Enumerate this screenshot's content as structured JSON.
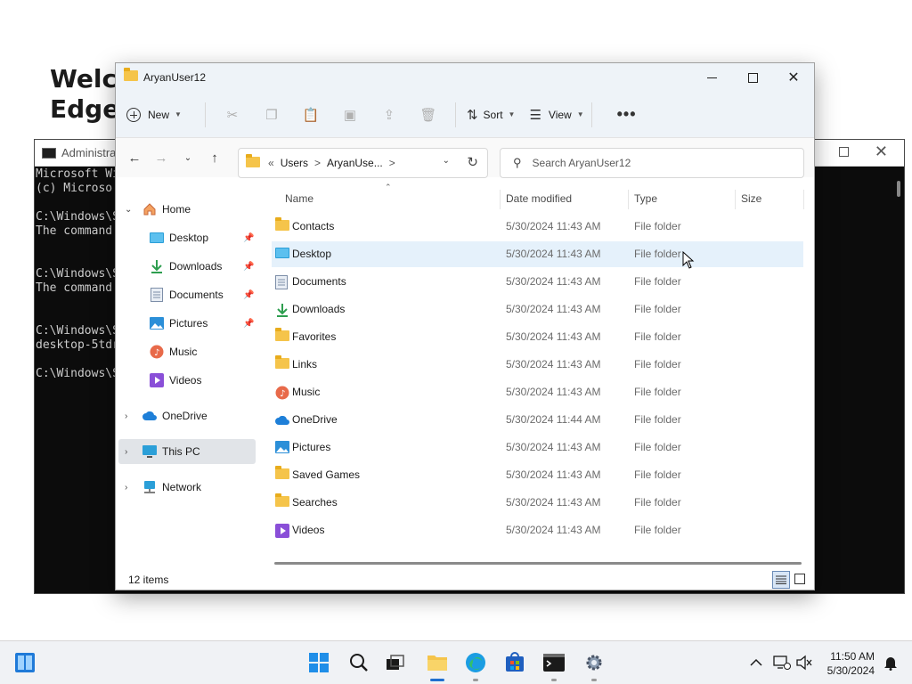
{
  "background": {
    "welcome_line1": "Welco",
    "welcome_line2": "Edge,"
  },
  "cmd": {
    "title": "Administrat",
    "lines": [
      "Microsoft Wi",
      "(c) Microso",
      "",
      "C:\\Windows\\S",
      "The command",
      "",
      "",
      "C:\\Windows\\S",
      "The command",
      "",
      "",
      "C:\\Windows\\S",
      "desktop-5tdr",
      "",
      "C:\\Windows\\S"
    ]
  },
  "explorer": {
    "title": "AryanUser12",
    "toolbar": {
      "new_label": "New",
      "sort_label": "Sort",
      "view_label": "View",
      "more_label": "•••"
    },
    "address": {
      "prefix": "«",
      "crumbs": [
        "Users",
        "AryanUse..."
      ],
      "separator": ">"
    },
    "search": {
      "placeholder": "Search AryanUser12"
    },
    "nav": {
      "home": "Home",
      "desktop": "Desktop",
      "downloads": "Downloads",
      "documents": "Documents",
      "pictures": "Pictures",
      "music": "Music",
      "videos": "Videos",
      "onedrive": "OneDrive",
      "thispc": "This PC",
      "network": "Network"
    },
    "columns": {
      "name": "Name",
      "date": "Date modified",
      "type": "Type",
      "size": "Size"
    },
    "files": [
      {
        "name": "Contacts",
        "date": "5/30/2024 11:43 AM",
        "type": "File folder",
        "icon": "folder-icon"
      },
      {
        "name": "Desktop",
        "date": "5/30/2024 11:43 AM",
        "type": "File folder",
        "icon": "desktop-icon"
      },
      {
        "name": "Documents",
        "date": "5/30/2024 11:43 AM",
        "type": "File folder",
        "icon": "documents-icon"
      },
      {
        "name": "Downloads",
        "date": "5/30/2024 11:43 AM",
        "type": "File folder",
        "icon": "download-icon"
      },
      {
        "name": "Favorites",
        "date": "5/30/2024 11:43 AM",
        "type": "File folder",
        "icon": "folder-icon"
      },
      {
        "name": "Links",
        "date": "5/30/2024 11:43 AM",
        "type": "File folder",
        "icon": "folder-icon"
      },
      {
        "name": "Music",
        "date": "5/30/2024 11:43 AM",
        "type": "File folder",
        "icon": "music-icon"
      },
      {
        "name": "OneDrive",
        "date": "5/30/2024 11:44 AM",
        "type": "File folder",
        "icon": "cloud-icon"
      },
      {
        "name": "Pictures",
        "date": "5/30/2024 11:43 AM",
        "type": "File folder",
        "icon": "pictures-icon"
      },
      {
        "name": "Saved Games",
        "date": "5/30/2024 11:43 AM",
        "type": "File folder",
        "icon": "folder-icon"
      },
      {
        "name": "Searches",
        "date": "5/30/2024 11:43 AM",
        "type": "File folder",
        "icon": "folder-icon"
      },
      {
        "name": "Videos",
        "date": "5/30/2024 11:43 AM",
        "type": "File folder",
        "icon": "videos-icon"
      }
    ],
    "status": "12 items"
  },
  "taskbar": {
    "time": "11:50 AM",
    "date": "5/30/2024"
  },
  "colors": {
    "accent": "#1f6fcf",
    "selection": "#e5f1fb",
    "folder": "#f5c44a"
  }
}
